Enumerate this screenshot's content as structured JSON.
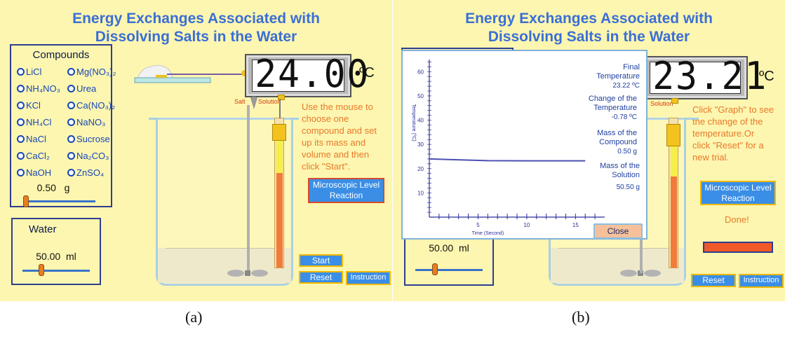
{
  "panel_a": {
    "title_line1": "Energy Exchanges Associated with",
    "title_line2": "Dissolving Salts in the Water",
    "compounds_heading": "Compounds",
    "compounds": [
      [
        "LiCl",
        "Mg(NO₃)₂"
      ],
      [
        "NH₄NO₃",
        "Urea"
      ],
      [
        "KCl",
        "Ca(NO₃)₂"
      ],
      [
        "NH₄Cl",
        "NaNO₃"
      ],
      [
        "NaCl",
        "Sucrose"
      ],
      [
        "CaCl₂",
        "Na₂CO₃"
      ],
      [
        "NaOH",
        "ZnSO₄"
      ]
    ],
    "mass_value": "0.50",
    "mass_unit": "g",
    "water_heading": "Water",
    "water_value": "50.00",
    "water_unit": "ml",
    "temperature_display": "24.00",
    "temperature_unit": "ºC",
    "salt_label": "Salt",
    "solution_label": "Solution",
    "instructions": [
      "Use the mouse to",
      "choose one",
      "compound and set",
      "up its mass and",
      "volume and then",
      "click \"Start\"."
    ],
    "micro_button": [
      "Microscopic Level",
      "Reaction"
    ],
    "start_button": "Start",
    "reset_button": "Reset",
    "instruction_button": "Instruction"
  },
  "panel_b": {
    "title_line1": "Energy Exchanges Associated with",
    "title_line2": "Dissolving Salts in the Water",
    "temperature_display": "23.21",
    "temperature_unit": "ºC",
    "solution_label": "Solution",
    "instructions": [
      "Click \"Graph\" to see",
      "the change of the",
      "temperature.Or",
      "click \"Reset\" for a",
      "new trial."
    ],
    "micro_button": [
      "Microscopic Level",
      "Reaction"
    ],
    "done_text": "Done!",
    "water_value": "50.00",
    "water_unit": "ml",
    "reset_button": "Reset",
    "instruction_button": "Instruction",
    "graph": {
      "final_temperature_label": [
        "Final",
        "Temperature"
      ],
      "final_temperature_value": "23.22 ºC",
      "change_label": [
        "Change of the",
        "Temperature"
      ],
      "change_value": "-0.78 ºC",
      "mass_compound_label": [
        "Mass of  the",
        "Compound"
      ],
      "mass_compound_value": "0.50  g",
      "mass_solution_label": [
        "Mass of the",
        "Solution"
      ],
      "mass_solution_value": "50.50  g",
      "close_button": "Close"
    }
  },
  "chart_data": {
    "type": "line",
    "xlabel": "Time (Second)",
    "ylabel": "Temperature (ºC)",
    "xlim": [
      0,
      18
    ],
    "ylim": [
      0,
      65
    ],
    "x_ticks": [
      5,
      10,
      15
    ],
    "y_ticks": [
      10,
      20,
      30,
      40,
      50,
      60
    ],
    "series": [
      {
        "x": [
          0,
          6,
          10,
          16
        ],
        "y": [
          24.0,
          23.3,
          23.22,
          23.22
        ]
      }
    ],
    "color": "#4a4fb0"
  },
  "captions": {
    "a": "(a)",
    "b": "(b)"
  }
}
